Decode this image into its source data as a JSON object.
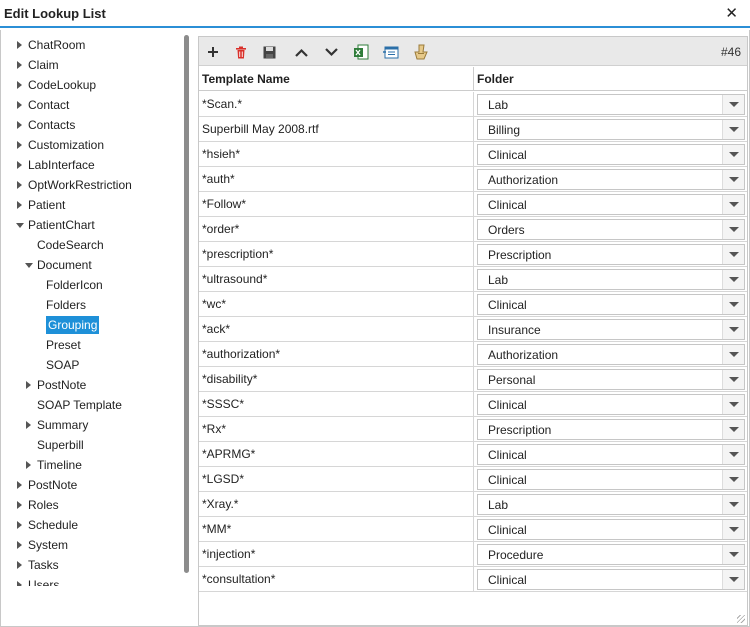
{
  "window": {
    "title": "Edit Lookup List",
    "close_glyph": "✕"
  },
  "tree": [
    {
      "label": "ChatRoom",
      "level": 0,
      "arrow": "right"
    },
    {
      "label": "Claim",
      "level": 0,
      "arrow": "right"
    },
    {
      "label": "CodeLookup",
      "level": 0,
      "arrow": "right"
    },
    {
      "label": "Contact",
      "level": 0,
      "arrow": "right"
    },
    {
      "label": "Contacts",
      "level": 0,
      "arrow": "right"
    },
    {
      "label": "Customization",
      "level": 0,
      "arrow": "right"
    },
    {
      "label": "LabInterface",
      "level": 0,
      "arrow": "right"
    },
    {
      "label": "OptWorkRestriction",
      "level": 0,
      "arrow": "right"
    },
    {
      "label": "Patient",
      "level": 0,
      "arrow": "right"
    },
    {
      "label": "PatientChart",
      "level": 0,
      "arrow": "down"
    },
    {
      "label": "CodeSearch",
      "level": 1,
      "arrow": "none"
    },
    {
      "label": "Document",
      "level": 1,
      "arrow": "down"
    },
    {
      "label": "FolderIcon",
      "level": 2,
      "arrow": "none"
    },
    {
      "label": "Folders",
      "level": 2,
      "arrow": "none"
    },
    {
      "label": "Grouping",
      "level": 2,
      "arrow": "none",
      "selected": true
    },
    {
      "label": "Preset",
      "level": 2,
      "arrow": "none"
    },
    {
      "label": "SOAP",
      "level": 2,
      "arrow": "none"
    },
    {
      "label": "PostNote",
      "level": 1,
      "arrow": "right"
    },
    {
      "label": "SOAP Template",
      "level": 1,
      "arrow": "none"
    },
    {
      "label": "Summary",
      "level": 1,
      "arrow": "right"
    },
    {
      "label": "Superbill",
      "level": 1,
      "arrow": "none"
    },
    {
      "label": "Timeline",
      "level": 1,
      "arrow": "right"
    },
    {
      "label": "PostNote",
      "level": 0,
      "arrow": "right"
    },
    {
      "label": "Roles",
      "level": 0,
      "arrow": "right"
    },
    {
      "label": "Schedule",
      "level": 0,
      "arrow": "right"
    },
    {
      "label": "System",
      "level": 0,
      "arrow": "right"
    },
    {
      "label": "Tasks",
      "level": 0,
      "arrow": "right"
    },
    {
      "label": "Users",
      "level": 0,
      "arrow": "right"
    }
  ],
  "toolbar": {
    "record_count": "#46",
    "icons": [
      "add-icon",
      "delete-icon",
      "save-icon",
      "move-up-icon",
      "move-down-icon",
      "excel-export-icon",
      "import-icon",
      "clear-icon"
    ]
  },
  "grid": {
    "headers": {
      "name": "Template Name",
      "folder": "Folder"
    },
    "rows": [
      {
        "name": "*Scan.*",
        "folder": "Lab"
      },
      {
        "name": "Superbill May 2008.rtf",
        "folder": "Billing"
      },
      {
        "name": "*hsieh*",
        "folder": "Clinical"
      },
      {
        "name": "*auth*",
        "folder": "Authorization"
      },
      {
        "name": "*Follow*",
        "folder": "Clinical"
      },
      {
        "name": "*order*",
        "folder": "Orders"
      },
      {
        "name": "*prescription*",
        "folder": "Prescription"
      },
      {
        "name": "*ultrasound*",
        "folder": "Lab"
      },
      {
        "name": "*wc*",
        "folder": "Clinical"
      },
      {
        "name": "*ack*",
        "folder": "Insurance"
      },
      {
        "name": "*authorization*",
        "folder": "Authorization"
      },
      {
        "name": "*disability*",
        "folder": "Personal"
      },
      {
        "name": "*SSSC*",
        "folder": "Clinical"
      },
      {
        "name": "*Rx*",
        "folder": "Prescription"
      },
      {
        "name": "*APRMG*",
        "folder": "Clinical"
      },
      {
        "name": "*LGSD*",
        "folder": "Clinical"
      },
      {
        "name": "*Xray.*",
        "folder": "Lab"
      },
      {
        "name": "*MM*",
        "folder": "Clinical"
      },
      {
        "name": "*injection*",
        "folder": "Procedure"
      },
      {
        "name": "*consultation*",
        "folder": "Clinical"
      }
    ]
  },
  "colors": {
    "accent": "#2b8fd6",
    "selected": "#1e90d8",
    "delete": "#d9302a",
    "toolbar": "#e9e9e9"
  }
}
